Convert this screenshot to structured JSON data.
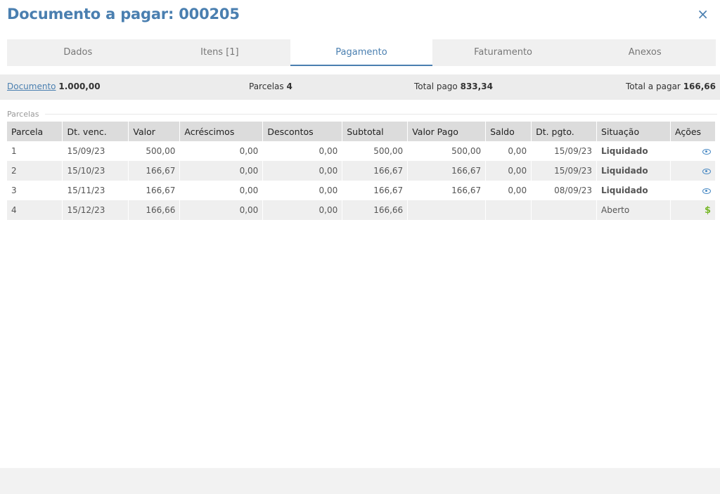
{
  "header": {
    "title": "Documento a pagar: 000205",
    "close_icon": "×"
  },
  "tabs": [
    {
      "label": "Dados",
      "active": false
    },
    {
      "label": "Itens [1]",
      "active": false
    },
    {
      "label": "Pagamento",
      "active": true
    },
    {
      "label": "Faturamento",
      "active": false
    },
    {
      "label": "Anexos",
      "active": false
    }
  ],
  "summary": {
    "documento_label": "Documento",
    "documento_value": "1.000,00",
    "parcelas_label": "Parcelas",
    "parcelas_value": "4",
    "total_pago_label": "Total pago",
    "total_pago_value": "833,34",
    "total_pagar_label": "Total a pagar",
    "total_pagar_value": "166,66"
  },
  "parcelas": {
    "legend": "Parcelas",
    "columns": [
      "Parcela",
      "Dt. venc.",
      "Valor",
      "Acréscimos",
      "Descontos",
      "Subtotal",
      "Valor Pago",
      "Saldo",
      "Dt. pgto.",
      "Situação",
      "Ações"
    ],
    "rows": [
      {
        "parcela": "1",
        "dt_venc": "15/09/23",
        "valor": "500,00",
        "acrescimos": "0,00",
        "descontos": "0,00",
        "subtotal": "500,00",
        "valor_pago": "500,00",
        "saldo": "0,00",
        "dt_pgto": "15/09/23",
        "situacao": "Liquidado",
        "acao": "view-icon"
      },
      {
        "parcela": "2",
        "dt_venc": "15/10/23",
        "valor": "166,67",
        "acrescimos": "0,00",
        "descontos": "0,00",
        "subtotal": "166,67",
        "valor_pago": "166,67",
        "saldo": "0,00",
        "dt_pgto": "15/09/23",
        "situacao": "Liquidado",
        "acao": "view-icon"
      },
      {
        "parcela": "3",
        "dt_venc": "15/11/23",
        "valor": "166,67",
        "acrescimos": "0,00",
        "descontos": "0,00",
        "subtotal": "166,67",
        "valor_pago": "166,67",
        "saldo": "0,00",
        "dt_pgto": "08/09/23",
        "situacao": "Liquidado",
        "acao": "view-icon"
      },
      {
        "parcela": "4",
        "dt_venc": "15/12/23",
        "valor": "166,66",
        "acrescimos": "0,00",
        "descontos": "0,00",
        "subtotal": "166,66",
        "valor_pago": "",
        "saldo": "",
        "dt_pgto": "",
        "situacao": "Aberto",
        "acao": "pay-dollar-icon",
        "acao_glyph": "$"
      }
    ]
  },
  "colors": {
    "accent": "#4a7fb0",
    "liquidado": "#2aa12a",
    "pay_icon": "#78b82a"
  }
}
